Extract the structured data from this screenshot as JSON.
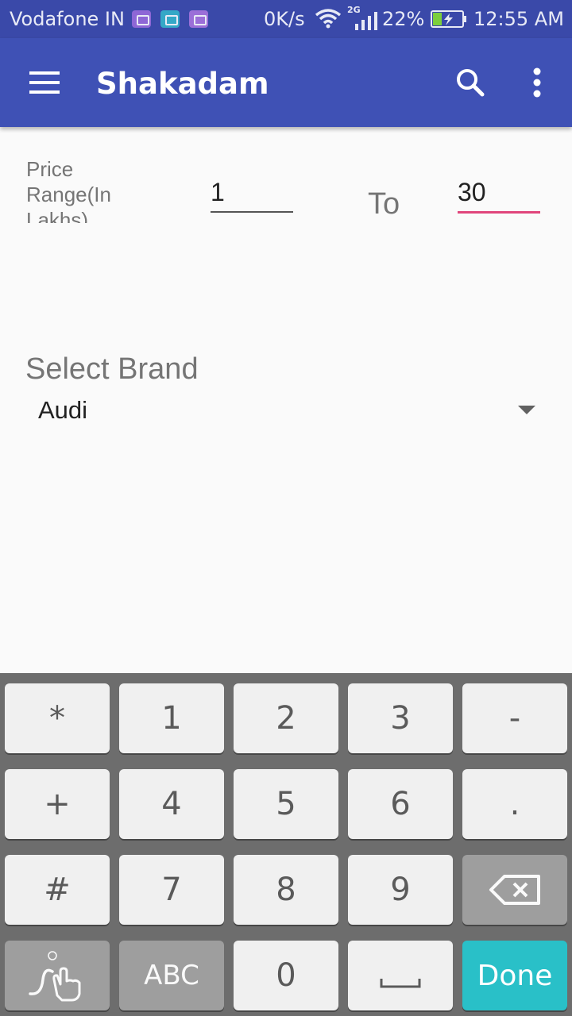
{
  "status_bar": {
    "carrier": "Vodafone IN",
    "speed": "0K/s",
    "network_type": "2G",
    "battery": "22%",
    "time": "12:55 AM"
  },
  "app_bar": {
    "title": "Shakadam",
    "colors": {
      "primary": "#3f51b5",
      "status": "#3a49a9",
      "accent": "#e0457b"
    }
  },
  "form": {
    "price_label": "Price Range(In Lakhs)",
    "price_from": "1",
    "to_label": "To",
    "price_to": "30",
    "select_brand_label": "Select Brand",
    "selected_brand": "Audi"
  },
  "keyboard": {
    "rows": [
      [
        "*",
        "1",
        "2",
        "3",
        "-"
      ],
      [
        "+",
        "4",
        "5",
        "6",
        "."
      ],
      [
        "#",
        "7",
        "8",
        "9",
        "backspace"
      ],
      [
        "gesture",
        "ABC",
        "0",
        "space",
        "Done"
      ]
    ],
    "done_label": "Done",
    "abc_label": "ABC"
  }
}
